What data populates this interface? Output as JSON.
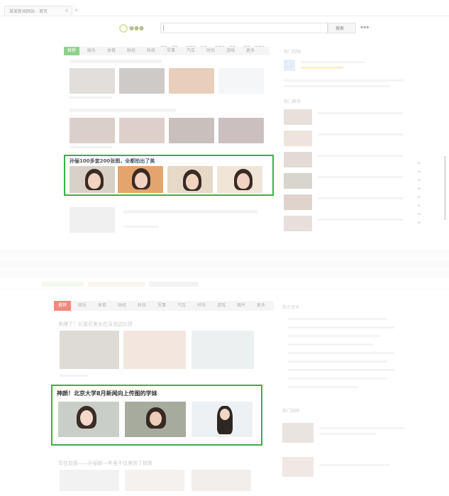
{
  "top": {
    "tab_title": "某某新闻网站 - 首页",
    "search_button": "搜索",
    "cat_tabs": [
      "推荐",
      "娱乐",
      "体育",
      "财经",
      "科技",
      "军事",
      "汽车",
      "时尚",
      "游戏",
      "更多"
    ],
    "highlight_title": "孙俪100多套200张图，全都拍出了美",
    "right_sections": [
      "热门视频",
      "热门推荐"
    ]
  },
  "bottom": {
    "cat_tabs": [
      "推荐",
      "娱乐",
      "体育",
      "财经",
      "科技",
      "军事",
      "汽车",
      "时尚",
      "游戏",
      "图片",
      "更多"
    ],
    "headline1": "美爆了！比基尼美女在泳池边比拼",
    "highlight_title": "神颜！北京大学8月新闻向上传图的学妹",
    "headline2": "写在前面——孙俪新一年里不仅美到了极致",
    "right_sections": [
      "热点资讯",
      "热门视频"
    ]
  },
  "colors": {
    "highlight": "#33b446",
    "active_tab_top": "#8fd18c",
    "active_tab_bottom": "#ef8a7c"
  }
}
